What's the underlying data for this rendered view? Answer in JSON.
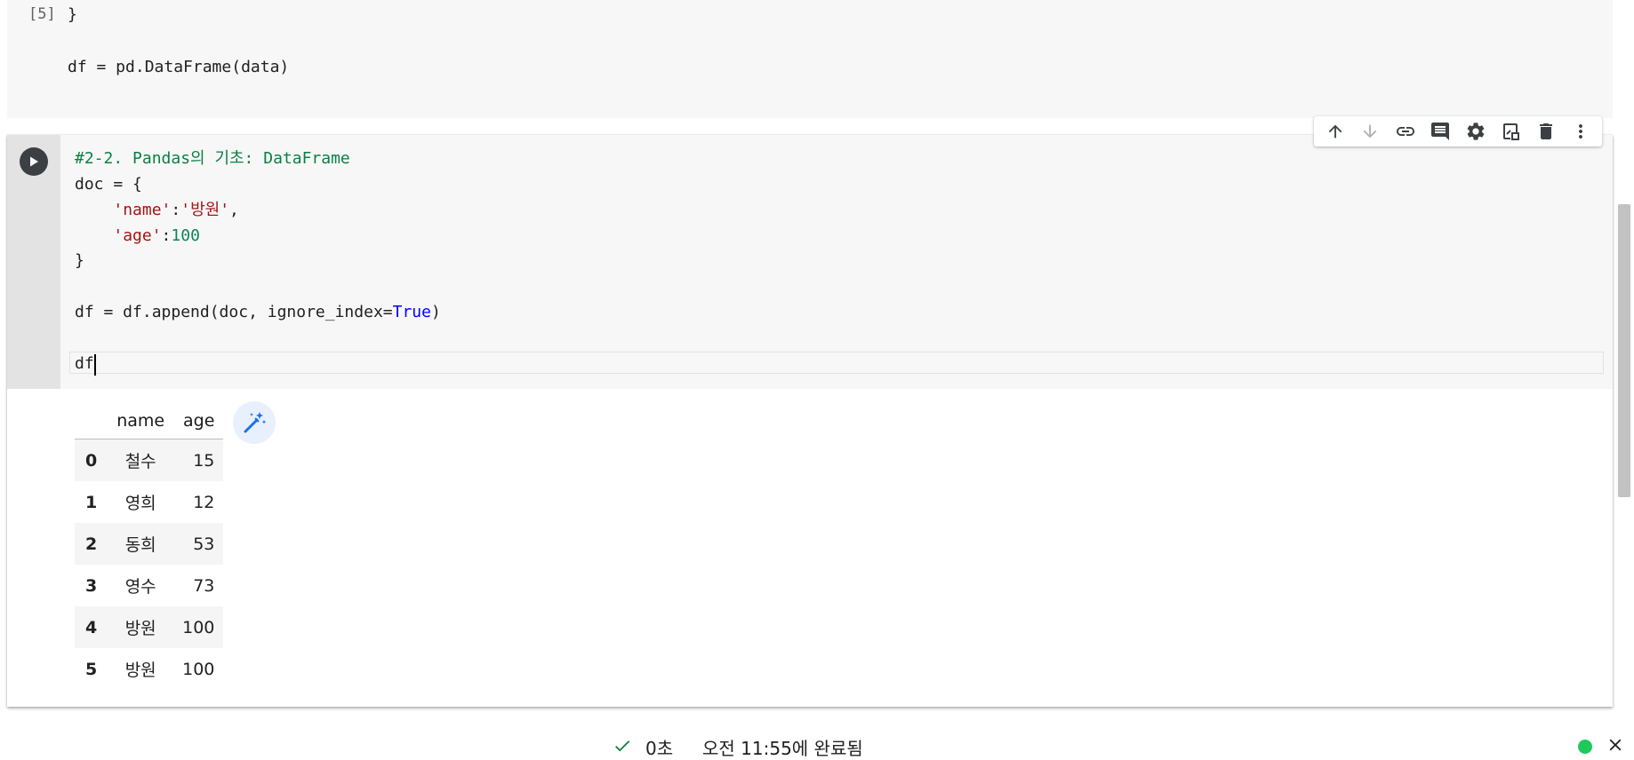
{
  "prev_cell": {
    "exec_count": "[5]",
    "lines": [
      "}",
      "df = pd.DataFrame(data)"
    ]
  },
  "active_cell": {
    "code": {
      "comment": "#2-2. Pandas의 기초: DataFrame",
      "doc_open": "doc = {",
      "name_key": "'name'",
      "colon1": ":",
      "name_val": "'방원'",
      "comma": ",",
      "age_key": "'age'",
      "colon2": ":",
      "age_val": "100",
      "close_brace": "}",
      "append_prefix": "df = df.append(doc, ignore_index=",
      "append_kw": "True",
      "append_suffix": ")",
      "last_line": "df"
    },
    "toolbar": {
      "icons": [
        "arrow-up-icon",
        "arrow-down-icon",
        "link-icon",
        "comment-icon",
        "gear-icon",
        "mirror-cell-icon",
        "trash-icon",
        "more-vert-icon"
      ]
    },
    "output": {
      "columns": [
        "",
        "name",
        "age"
      ],
      "rows": [
        {
          "index": "0",
          "name": "철수",
          "age": "15"
        },
        {
          "index": "1",
          "name": "영희",
          "age": "12"
        },
        {
          "index": "2",
          "name": "동희",
          "age": "53"
        },
        {
          "index": "3",
          "name": "영수",
          "age": "73"
        },
        {
          "index": "4",
          "name": "방원",
          "age": "100"
        },
        {
          "index": "5",
          "name": "방원",
          "age": "100"
        }
      ],
      "magic_icon": "magic-wand-icon"
    }
  },
  "status_bar": {
    "duration": "0초",
    "completed": "오전 11:55에 완료됨",
    "status_color": "#1ec95a"
  },
  "colors": {
    "comment": "#0b8043",
    "string": "#a31515",
    "number": "#098658",
    "keyword": "#0000ff"
  }
}
